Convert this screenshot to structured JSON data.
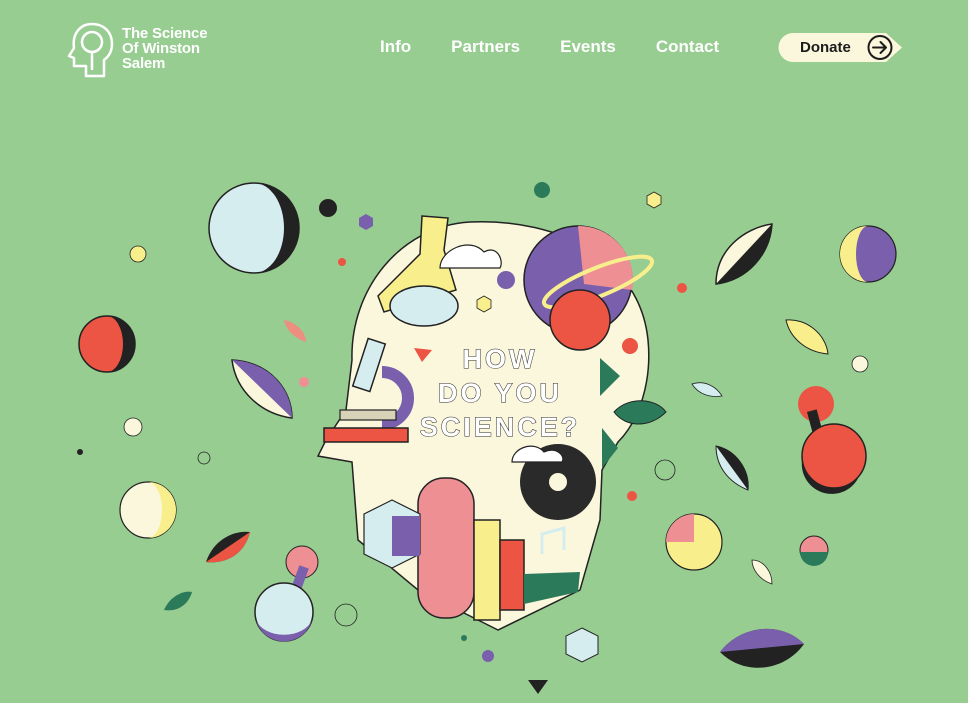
{
  "header": {
    "logo": {
      "line1": "The Science",
      "line2": "Of Winston",
      "line3": "Salem",
      "icon": "head-outline-logo-icon"
    },
    "nav": [
      {
        "label": "Info"
      },
      {
        "label": "Partners"
      },
      {
        "label": "Events"
      },
      {
        "label": "Contact"
      }
    ],
    "donate": {
      "label": "Donate",
      "icon": "arrow-right-circle-icon"
    }
  },
  "hero": {
    "headline": [
      "HOW",
      "DO YOU",
      "SCIENCE?"
    ],
    "illustration": "head-silhouette-science-collage"
  },
  "colors": {
    "background": "#98cd92",
    "cream": "#fbf7dc",
    "purple": "#7a5fad",
    "red": "#ec5443",
    "pink": "#ee8f94",
    "yellow": "#f8ef8c",
    "light_blue": "#d6edf0",
    "dark_green": "#2b7a5a",
    "black": "#222222"
  }
}
